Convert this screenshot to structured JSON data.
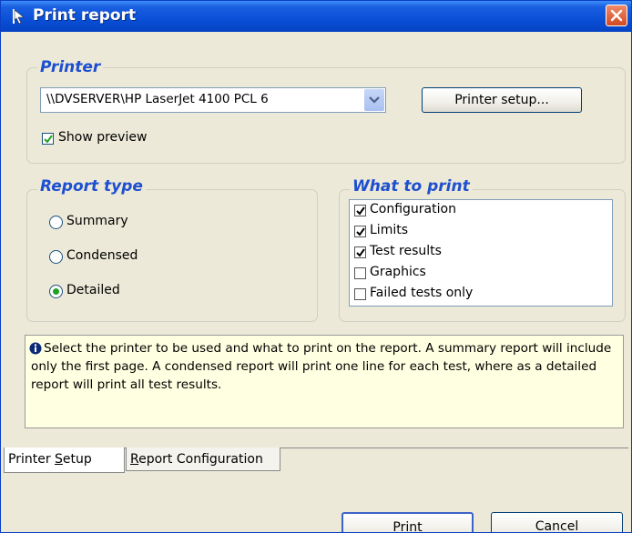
{
  "window": {
    "title": "Print report"
  },
  "printer_group": {
    "legend": "Printer",
    "selected_printer": "\\\\DVSERVER\\HP LaserJet 4100 PCL 6",
    "setup_button": "Printer setup...",
    "show_preview_label": "Show preview",
    "show_preview_checked": true
  },
  "report_type": {
    "legend": "Report type",
    "options": [
      "Summary",
      "Condensed",
      "Detailed"
    ],
    "selected": "Detailed"
  },
  "what_to_print": {
    "legend": "What to print",
    "items": [
      {
        "label": "Configuration",
        "checked": true
      },
      {
        "label": "Limits",
        "checked": true
      },
      {
        "label": "Test results",
        "checked": true
      },
      {
        "label": "Graphics",
        "checked": false
      },
      {
        "label": "Failed tests only",
        "checked": false
      }
    ]
  },
  "info_text": "Select the printer to be used and what to print on the report. A summary report will include only the first page. A condensed report will print one line for each test, where as a detailed report will print all test results.",
  "tabs": [
    {
      "label": "Printer Setup",
      "accel": "S",
      "active": true
    },
    {
      "label": "Report Configuration",
      "accel": "R",
      "active": false
    }
  ],
  "buttons": {
    "print": "Print",
    "cancel": "Cancel"
  },
  "colors": {
    "title_bar": "#0a4fd6",
    "legend_text": "#1d4fd0",
    "info_background": "#ffffe1",
    "close_button": "#d44a20"
  },
  "icons": {
    "app": "flag-cursor-icon",
    "close": "close-icon",
    "info": "info-icon",
    "dropdown": "chevron-down-icon"
  }
}
